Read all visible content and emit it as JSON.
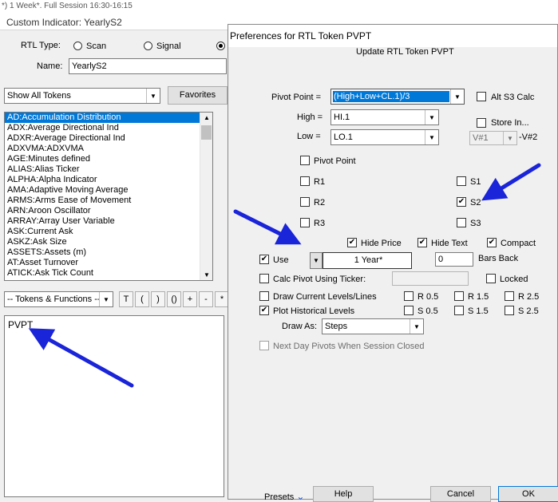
{
  "background": {
    "top_text": "*) 1 Week*. Full Session 16:30-16:15",
    "window_title": "Custom Indicator: YearlyS2",
    "rtl_type_label": "RTL Type:",
    "radio_scan": "Scan",
    "radio_signal": "Signal",
    "name_label": "Name:",
    "name_value": "YearlyS2",
    "token_filter": "Show All Tokens",
    "favorites": "Favorites",
    "token_items": [
      "AD:Accumulation Distribution",
      "ADX:Average Directional Ind",
      "ADXR:Average Directional Ind",
      "ADXVMA:ADXVMA",
      "AGE:Minutes defined",
      "ALIAS:Alias Ticker",
      "ALPHA:Alpha Indicator",
      "AMA:Adaptive Moving Average",
      "ARMS:Arms Ease of Movement",
      "ARN:Aroon Oscillator",
      "ARRAY:Array User Variable",
      "ASK:Current Ask",
      "ASKZ:Ask Size",
      "ASSETS:Assets (m)",
      "AT:Asset Turnover",
      "ATICK:Ask Tick Count"
    ],
    "tokens_functions": "-- Tokens & Functions --",
    "op_buttons": [
      "T",
      "(",
      ")",
      "()",
      "+",
      "-",
      "*"
    ],
    "formula_text": "PVPT"
  },
  "dialog": {
    "title": "Preferences for RTL Token PVPT",
    "subtitle": "Update RTL Token PVPT",
    "pivot_point_label": "Pivot Point =",
    "pivot_point_value": "(High+Low+CL.1)/3",
    "alt_s3_calc": "Alt S3 Calc",
    "high_label": "High =",
    "high_value": "HI.1",
    "low_label": "Low =",
    "low_value": "LO.1",
    "store_in": "Store In...",
    "store_value": "V#1",
    "store_suffix": "-V#2",
    "pivot_point_cb": "Pivot Point",
    "r1": "R1",
    "r2": "R2",
    "r3": "R3",
    "s1": "S1",
    "s2": "S2",
    "s3": "S3",
    "hide_price": "Hide Price",
    "hide_text": "Hide Text",
    "compact": "Compact",
    "use_label": "Use",
    "period_value": "1 Year*",
    "bars_back_value": "0",
    "bars_back_label": "Bars Back",
    "calc_pivot_ticker": "Calc Pivot Using Ticker:",
    "locked": "Locked",
    "draw_current": "Draw Current Levels/Lines",
    "plot_historical": "Plot Historical Levels",
    "r05": "R 0.5",
    "r15": "R 1.5",
    "r25": "R 2.5",
    "s05": "S 0.5",
    "s15": "S 1.5",
    "s25": "S 2.5",
    "draw_as_label": "Draw As:",
    "draw_as_value": "Steps",
    "next_day_pivots": "Next Day Pivots When Session Closed",
    "presets": "Presets",
    "help": "Help",
    "cancel": "Cancel",
    "ok": "OK",
    "checked": {
      "hide_price": true,
      "hide_text": true,
      "compact": true,
      "use": true,
      "plot_historical": true,
      "s2": true
    }
  },
  "annotation_color": "#1a24d8"
}
